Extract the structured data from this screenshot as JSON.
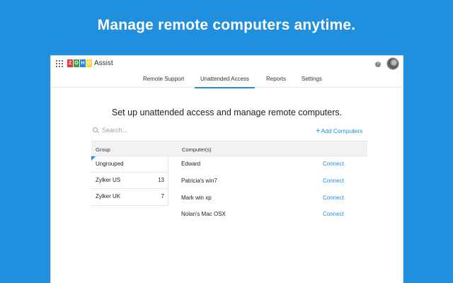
{
  "headline": "Manage remote computers anytime.",
  "app": {
    "logo_letters": [
      {
        "letter": "Z",
        "color": "#e53935"
      },
      {
        "letter": "O",
        "color": "#43a047"
      },
      {
        "letter": "H",
        "color": "#1e88e5"
      },
      {
        "letter": "O",
        "color": "#fdd835"
      }
    ],
    "name": "Assist"
  },
  "topbar": {
    "help_icon": "question-icon",
    "help_glyph": "?"
  },
  "tabs": [
    {
      "label": "Remote Support",
      "active": false
    },
    {
      "label": "Unattended Access",
      "active": true
    },
    {
      "label": "Reports",
      "active": false
    },
    {
      "label": "Settings",
      "active": false
    }
  ],
  "main": {
    "title": "Set up unattended access and manage remote computers.",
    "search_placeholder": "Search...",
    "add_plus": "+",
    "add_label": "Add Computers"
  },
  "table": {
    "group_header": "Group",
    "computer_header": "Computer(s)"
  },
  "groups": [
    {
      "name": "Ungrouped",
      "count": ""
    },
    {
      "name": "Zylker US",
      "count": "13"
    },
    {
      "name": "Zylker UK",
      "count": "7"
    }
  ],
  "computers": [
    {
      "name": "Edward",
      "action": "Connect"
    },
    {
      "name": "Patricia's win7",
      "action": "Connect"
    },
    {
      "name": "Mark win xp",
      "action": "Connect"
    },
    {
      "name": "Nolan's Mac OSX",
      "action": "Connect"
    }
  ],
  "colors": {
    "brand_blue": "#1f8fde"
  }
}
